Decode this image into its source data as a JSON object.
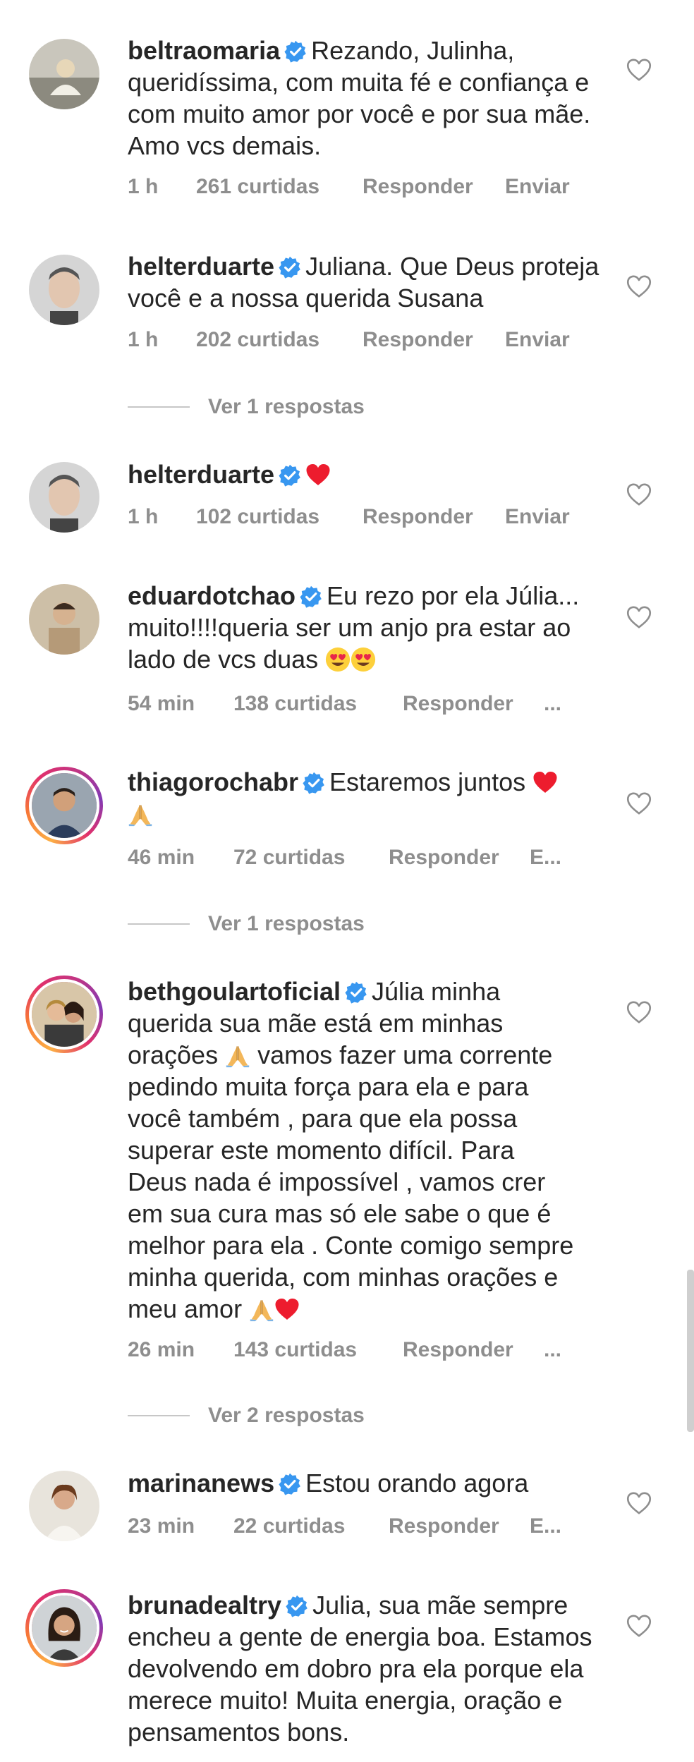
{
  "comments": [
    {
      "username": "beltraomaria",
      "text": "Rezando, Julinha, queridíssima, com muita fé e confiança e com muito amor por você e por sua mãe. Amo vcs demais.",
      "time": "1 h",
      "likes": "261 curtidas",
      "reply": "Responder",
      "send": "Enviar"
    },
    {
      "username": "helterduarte",
      "text": "Juliana. Que Deus proteja você e a nossa querida Susana",
      "time": "1 h",
      "likes": "202 curtidas",
      "reply": "Responder",
      "send": "Enviar"
    },
    {
      "username": "helterduarte",
      "text": "",
      "emoji": "red-heart",
      "time": "1 h",
      "likes": "102 curtidas",
      "reply": "Responder",
      "send": "Enviar"
    },
    {
      "username": "eduardotchao",
      "text": "Eu rezo por ela Júlia... muito!!!!queria ser um anjo pra estar ao lado de vcs duas",
      "time": "54 min",
      "likes": "138 curtidas",
      "reply": "Responder",
      "send": "..."
    },
    {
      "username": "thiagorochabr",
      "text": "Estaremos juntos",
      "time": "46 min",
      "likes": "72 curtidas",
      "reply": "Responder",
      "send": "E..."
    },
    {
      "username": "bethgoulartoficial",
      "text_lines": [
        "Júlia minha",
        "querida sua mãe está em minhas",
        "orações",
        "vamos fazer uma corrente",
        "pedindo muita força para ela e para",
        "você também , para que ela possa",
        "superar este momento difícil. Para",
        "Deus nada é impossível , vamos crer",
        "em sua cura mas só ele sabe o que é",
        "melhor para ela . Conte comigo sempre",
        "minha querida, com minhas orações e",
        "meu amor"
      ],
      "time": "26 min",
      "likes": "143 curtidas",
      "reply": "Responder",
      "send": "..."
    },
    {
      "username": "marinanews",
      "text": "Estou orando agora",
      "time": "23 min",
      "likes": "22 curtidas",
      "reply": "Responder",
      "send": "E..."
    },
    {
      "username": "brunadealtry",
      "text": "Julia, sua mãe sempre encheu a gente de energia boa. Estamos devolvendo em dobro pra ela porque ela merece muito! Muita energia, oração e pensamentos bons.",
      "time": "",
      "likes": "",
      "reply": "",
      "send": ""
    }
  ],
  "view_replies": [
    "Ver 1 respostas",
    "Ver 1 respostas",
    "Ver 2 respostas"
  ],
  "colors": {
    "text": "#262626",
    "meta": "#8e8e8e",
    "verified": "#3897f0",
    "heart_red": "#ed1c2e"
  },
  "icons": [
    "verified-badge-icon",
    "like-heart-icon",
    "red-heart-emoji",
    "smiling-heart-eyes-emoji",
    "praying-hands-emoji"
  ]
}
